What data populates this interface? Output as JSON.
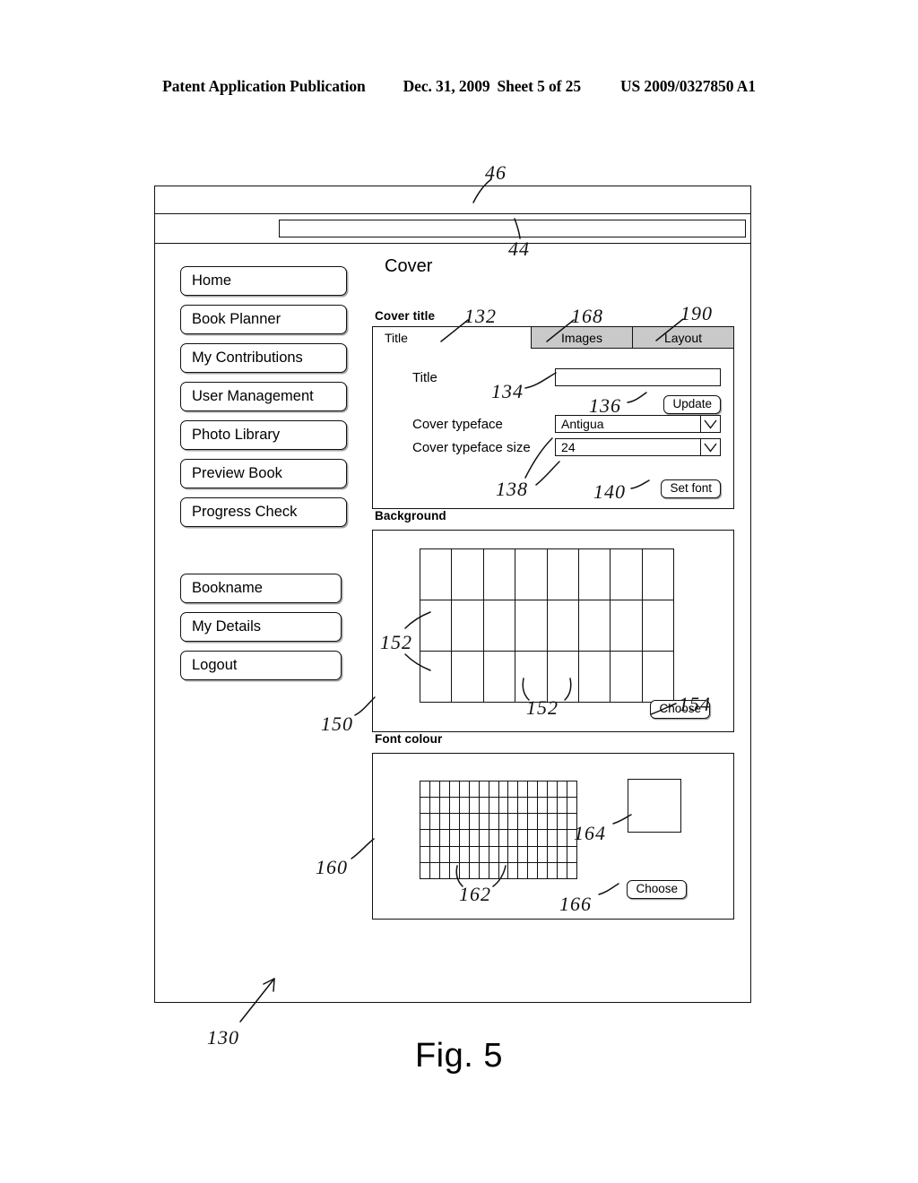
{
  "publication_header": {
    "left": "Patent Application Publication",
    "date": "Dec. 31, 2009",
    "sheet": "Sheet 5 of 25",
    "number": "US 2009/0327850 A1"
  },
  "figure": {
    "caption": "Fig. 5"
  },
  "browser": {
    "toolbar_blank_label": "",
    "address_value": "",
    "address_placeholder": ""
  },
  "sidebar": {
    "primary_items": [
      {
        "label": "Home"
      },
      {
        "label": "Book Planner"
      },
      {
        "label": "My Contributions"
      },
      {
        "label": "User Management"
      },
      {
        "label": "Photo Library"
      },
      {
        "label": "Preview Book"
      },
      {
        "label": "Progress Check"
      }
    ],
    "secondary_items": [
      {
        "label": "Bookname"
      },
      {
        "label": "My Details"
      },
      {
        "label": "Logout"
      }
    ]
  },
  "main": {
    "page_title": "Cover",
    "cover_title": {
      "section_label": "Cover title",
      "tabs": [
        {
          "label": "Title",
          "active": true
        },
        {
          "label": "Images",
          "active": false
        },
        {
          "label": "Layout",
          "active": false
        }
      ],
      "title_field_label": "Title",
      "title_field_value": "",
      "update_button": "Update",
      "typeface_label": "Cover typeface",
      "typeface_value": "Antigua",
      "typeface_size_label": "Cover typeface size",
      "typeface_size_value": "24",
      "set_font_button": "Set font"
    },
    "background": {
      "section_label": "Background",
      "grid_columns": 8,
      "grid_rows": 3,
      "choose_button": "Choose"
    },
    "font_colour": {
      "section_label": "Font colour",
      "grid_columns": 16,
      "grid_rows": 6,
      "swatch_colour": "#ffffff",
      "choose_button": "Choose"
    }
  },
  "reference_numerals": [
    {
      "id": "46",
      "desc": "browser toolbar"
    },
    {
      "id": "44",
      "desc": "address bar"
    },
    {
      "id": "132",
      "desc": "title tab"
    },
    {
      "id": "168",
      "desc": "images tab"
    },
    {
      "id": "190",
      "desc": "layout tab"
    },
    {
      "id": "134",
      "desc": "title text field"
    },
    {
      "id": "136",
      "desc": "update button"
    },
    {
      "id": "138",
      "desc": "typeface selectors"
    },
    {
      "id": "140",
      "desc": "set font button"
    },
    {
      "id": "150",
      "desc": "background panel"
    },
    {
      "id": "152",
      "desc": "background swatch cell"
    },
    {
      "id": "154",
      "desc": "background choose button"
    },
    {
      "id": "160",
      "desc": "font colour panel"
    },
    {
      "id": "162",
      "desc": "font colour swatch cell"
    },
    {
      "id": "164",
      "desc": "font colour preview"
    },
    {
      "id": "166",
      "desc": "font colour choose button"
    },
    {
      "id": "130",
      "desc": "cover editing screen"
    }
  ]
}
